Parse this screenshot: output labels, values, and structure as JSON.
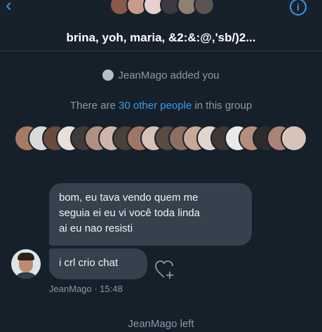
{
  "header": {
    "back_icon": "chevron-left-icon",
    "info_icon": "info-icon",
    "title": "brina, yoh, maria, &2:&:@,'sb/)2...",
    "avatar_colors": [
      "#8a5a4a",
      "#c89a8c",
      "#e6d2cc",
      "#3c3a40",
      "#8f8070",
      "#5a5550"
    ]
  },
  "events": {
    "added": "JeanMago added you",
    "others_prefix": "There are",
    "others_link": "30 other people",
    "others_suffix": "in this group",
    "left": "JeanMago left"
  },
  "member_avatar_colors": [
    "#a57b63",
    "#d9d9d9",
    "#6b4a3a",
    "#e8e0d8",
    "#3f3b38",
    "#b28f7f",
    "#cdb6a9",
    "#49403a",
    "#9e7666",
    "#d8c2b5",
    "#5a4a44",
    "#8c6e62",
    "#c9a897",
    "#e2d5cc",
    "#403633",
    "#e9e9e9",
    "#b48e7c",
    "#2e2b2a",
    "#a98474",
    "#d6c4bb"
  ],
  "messages": [
    {
      "lines": [
        "bom, eu tava vendo quem me",
        "seguia ei eu vi você toda linda",
        "ai eu nao resisti"
      ]
    },
    {
      "text": "i crl crio chat"
    }
  ],
  "message_meta": {
    "sender": "JeanMago",
    "time": "15:48"
  },
  "reaction_icon": "heart-plus-icon"
}
